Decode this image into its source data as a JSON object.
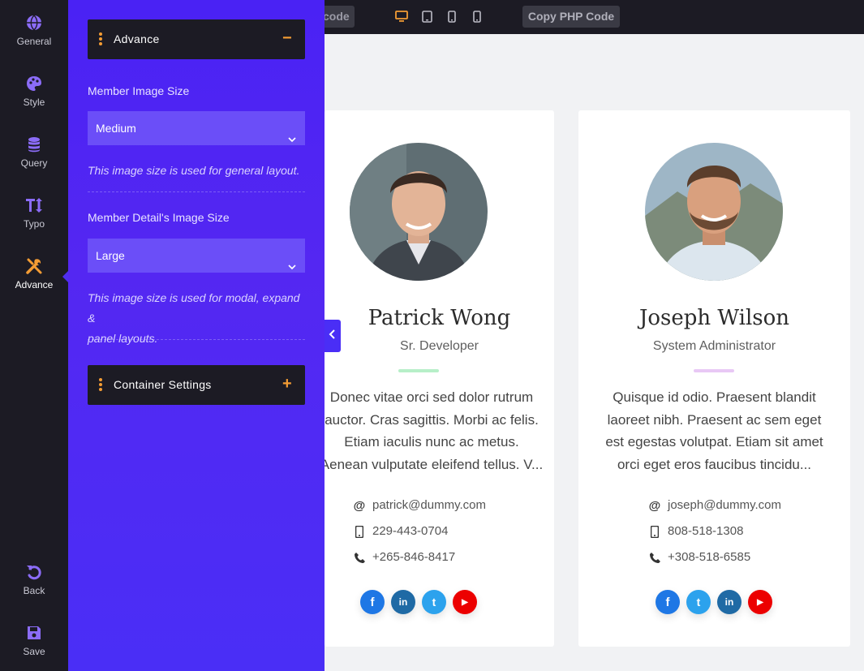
{
  "topbar": {
    "shortcode_label": "code",
    "devices": [
      "desktop-icon",
      "tablet-icon",
      "mobile-landscape-icon",
      "mobile-icon"
    ],
    "copy_php_label": "Copy PHP Code",
    "active_device_color": "#f39c34"
  },
  "rail": {
    "items": [
      {
        "label": "General",
        "icon": "globe-icon"
      },
      {
        "label": "Style",
        "icon": "palette-icon"
      },
      {
        "label": "Query",
        "icon": "database-icon"
      },
      {
        "label": "Typo",
        "icon": "text-height-icon"
      },
      {
        "label": "Advance",
        "icon": "tools-icon",
        "active": true
      },
      {
        "label": "Back",
        "icon": "undo-icon"
      },
      {
        "label": "Save",
        "icon": "floppy-disk-icon"
      }
    ],
    "icon_color": "#8b6cf7",
    "active_icon_color": "#f39c34"
  },
  "panel": {
    "advance": {
      "title": "Advance",
      "toggle": "−"
    },
    "member_image_size": {
      "label": "Member Image Size",
      "value": "Medium",
      "hint": "This image size is used for general layout."
    },
    "member_detail_image_size": {
      "label": "Member Detail's Image Size",
      "value": "Large",
      "hint_line1": "This image size is used for modal, expand &",
      "hint_line2": "panel layouts."
    },
    "container": {
      "title": "Container Settings",
      "toggle": "+"
    },
    "accent": "#4a22f4"
  },
  "cards": [
    {
      "name": "Patrick Wong",
      "role": "Sr. Developer",
      "bar_color": "#b7efc8",
      "bio": [
        "Donec vitae orci sed dolor rutrum",
        "auctor. Cras sagittis. Morbi ac felis.",
        "Etiam iaculis nunc ac metus.",
        "Aenean vulputate eleifend tellus. V..."
      ],
      "email": "patrick@dummy.com",
      "mobile": "229-443-0704",
      "phone": "+265-846-8417",
      "socials": [
        {
          "name": "facebook-icon",
          "glyph": "f",
          "color": "#1e77e5"
        },
        {
          "name": "linkedin-icon",
          "glyph": "in",
          "color": "#1f6aa5"
        },
        {
          "name": "twitter-icon",
          "glyph": "t",
          "color": "#2ca2ed"
        },
        {
          "name": "youtube-icon",
          "glyph": "▶",
          "color": "#ec0000"
        }
      ]
    },
    {
      "name": "Joseph Wilson",
      "role": "System Administrator",
      "bar_color": "#e8c8f5",
      "bio": [
        "Quisque id odio. Praesent blandit",
        "laoreet nibh. Praesent ac sem eget",
        "est egestas volutpat. Etiam sit amet",
        "orci eget eros faucibus tincidu..."
      ],
      "email": "joseph@dummy.com",
      "mobile": "808-518-1308",
      "phone": "+308-518-6585",
      "socials": [
        {
          "name": "facebook-icon",
          "glyph": "f",
          "color": "#1e77e5"
        },
        {
          "name": "twitter-icon",
          "glyph": "t",
          "color": "#2ca2ed"
        },
        {
          "name": "linkedin-icon",
          "glyph": "in",
          "color": "#1f6aa5"
        },
        {
          "name": "youtube-icon",
          "glyph": "▶",
          "color": "#ec0000"
        }
      ]
    }
  ]
}
